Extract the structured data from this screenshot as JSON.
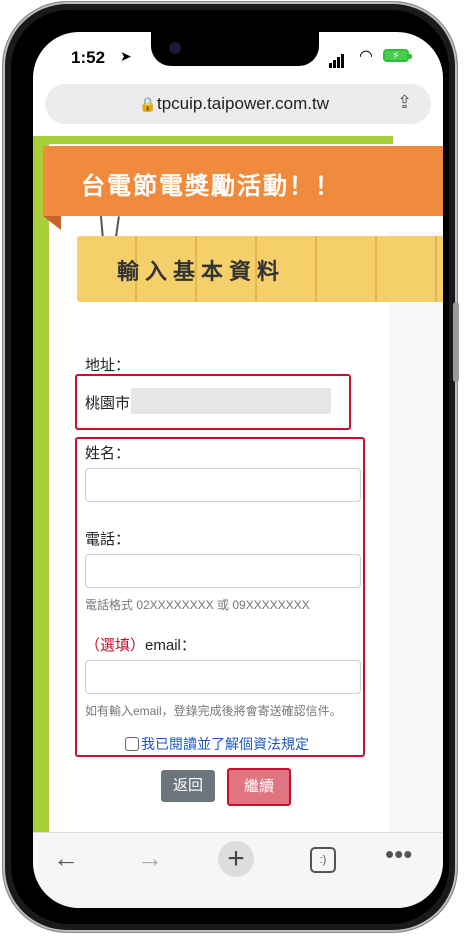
{
  "status_bar": {
    "time": "1:52"
  },
  "browser": {
    "url": "tpcuip.taipower.com.tw"
  },
  "page": {
    "banner_title": "台電節電獎勵活動！！",
    "section_title": "輸入基本資料",
    "address": {
      "label": "地址：",
      "value": "桃園市"
    },
    "name": {
      "label": "姓名：",
      "value": "",
      "placeholder": ""
    },
    "phone": {
      "label": "電話：",
      "value": "",
      "placeholder": "",
      "hint": "電話格式 02XXXXXXXX 或 09XXXXXXXX"
    },
    "email": {
      "optional_tag": "（選填）",
      "label": "email：",
      "value": "",
      "placeholder": "",
      "hint": "如有輸入email，登錄完成後將會寄送確認信件。"
    },
    "privacy_label": "我已閱讀並了解個資法規定",
    "back_label": "返回",
    "continue_label": "繼續"
  },
  "toolbar": {
    "icons": [
      "back-arrow-icon",
      "forward-arrow-icon",
      "new-tab-plus-icon",
      "tabs-icon",
      "more-icon"
    ],
    "tabs_glyph": ":)"
  }
}
